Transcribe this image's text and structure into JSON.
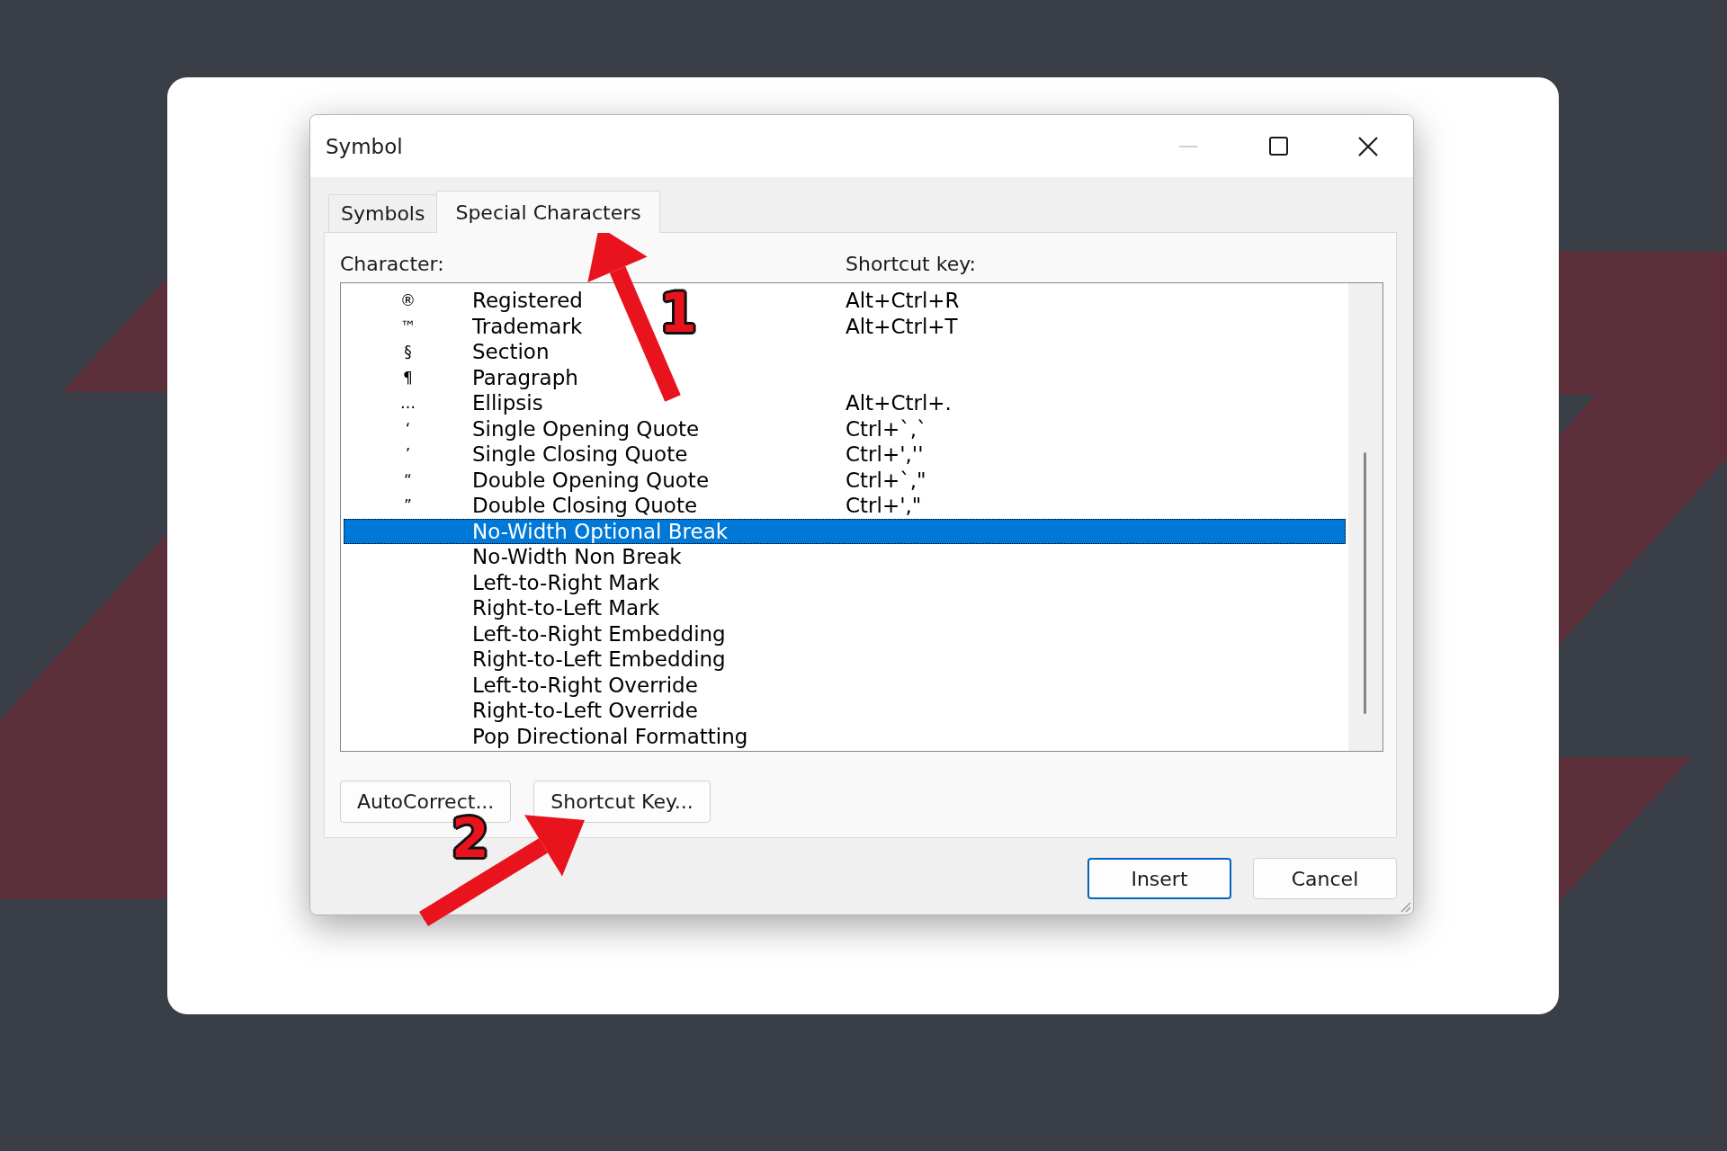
{
  "window": {
    "title": "Symbol",
    "title_buttons": [
      {
        "kind": "minimize",
        "disabled": true
      },
      {
        "kind": "maximize",
        "disabled": false
      },
      {
        "kind": "close",
        "disabled": false
      }
    ]
  },
  "tabs": [
    {
      "label": "Symbols",
      "selected": false
    },
    {
      "label": "Special Characters",
      "selected": true
    }
  ],
  "list": {
    "columns": [
      "Character:",
      "Shortcut key:"
    ],
    "rows": [
      {
        "symbol": "®",
        "name": "Registered",
        "shortcut": "Alt+Ctrl+R",
        "selected": false
      },
      {
        "symbol": "™",
        "name": "Trademark",
        "shortcut": "Alt+Ctrl+T",
        "selected": false
      },
      {
        "symbol": "§",
        "name": "Section",
        "selected": false
      },
      {
        "symbol": "¶",
        "name": "Paragraph",
        "selected": false
      },
      {
        "symbol": "…",
        "name": "Ellipsis",
        "shortcut": "Alt+Ctrl+.",
        "selected": false
      },
      {
        "symbol": "‘",
        "name": "Single Opening Quote",
        "shortcut": "Ctrl+`,`",
        "selected": false
      },
      {
        "symbol": "’",
        "name": "Single Closing Quote",
        "shortcut": "Ctrl+',''",
        "selected": false
      },
      {
        "symbol": "“",
        "name": "Double Opening Quote",
        "shortcut": "Ctrl+`,\"",
        "selected": false
      },
      {
        "symbol": "”",
        "name": "Double Closing Quote",
        "shortcut": "Ctrl+',\"",
        "selected": false
      },
      {
        "name": "No-Width Optional Break",
        "selected": true
      },
      {
        "name": "No-Width Non Break",
        "selected": false
      },
      {
        "name": "Left-to-Right Mark",
        "selected": false
      },
      {
        "name": "Right-to-Left Mark",
        "selected": false
      },
      {
        "name": "Left-to-Right Embedding",
        "selected": false
      },
      {
        "name": "Right-to-Left Embedding",
        "selected": false
      },
      {
        "name": "Left-to-Right Override",
        "selected": false
      },
      {
        "name": "Right-to-Left Override",
        "selected": false
      },
      {
        "name": "Pop Directional Formatting",
        "selected": false
      }
    ]
  },
  "panel_buttons": [
    "AutoCorrect...",
    "Shortcut Key..."
  ],
  "dialog_buttons": [
    {
      "label": "Insert",
      "default": true
    },
    {
      "label": "Cancel",
      "default": false
    }
  ],
  "annotations": [
    {
      "number": "1"
    },
    {
      "number": "2"
    }
  ]
}
